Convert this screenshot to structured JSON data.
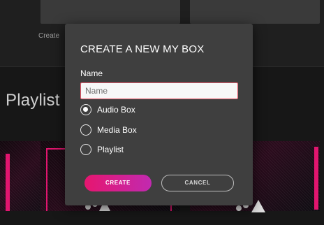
{
  "background": {
    "create_label": "Create",
    "section_heading": "Playlist"
  },
  "modal": {
    "title": "CREATE A NEW MY BOX",
    "name_label": "Name",
    "name_input": {
      "value": "",
      "placeholder": "Name"
    },
    "box_types": [
      {
        "label": "Audio Box",
        "selected": true
      },
      {
        "label": "Media Box",
        "selected": false
      },
      {
        "label": "Playlist",
        "selected": false
      }
    ],
    "create_button": "CREATE",
    "cancel_button": "CANCEL"
  },
  "colors": {
    "accent_start": "#e6166f",
    "accent_end": "#c12ab0",
    "modal_bg": "#3f3f3f",
    "input_border": "#e75a6b"
  }
}
